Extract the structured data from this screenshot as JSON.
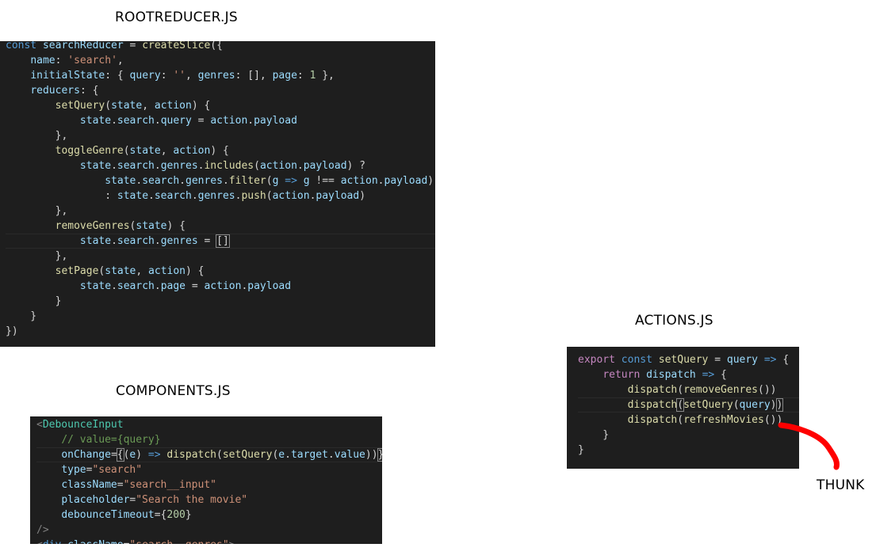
{
  "captions": {
    "rootreducer": "ROOTREDUCER.JS",
    "components": "COMPONENTS.JS",
    "actions": "ACTIONS.JS",
    "thunk": "THUNK"
  },
  "colors": {
    "editor_bg": "#1e1e1e",
    "keyword": "#569cd6",
    "control": "#c586c0",
    "variable": "#9cdcfe",
    "function": "#dcdcaa",
    "string": "#ce9178",
    "number": "#b5cea8",
    "comment": "#6a9955",
    "tag": "#4ec9b0",
    "arrow_annotation": "#ff0000"
  },
  "rootreducer_code": [
    [
      [
        "kw",
        "const"
      ],
      [
        "pun",
        " "
      ],
      [
        "var",
        "searchReducer"
      ],
      [
        "pun",
        " = "
      ],
      [
        "fn",
        "createSlice"
      ],
      [
        "pun",
        "({"
      ]
    ],
    [
      [
        "pun",
        "    "
      ],
      [
        "var",
        "name"
      ],
      [
        "pun",
        ": "
      ],
      [
        "str",
        "'search'"
      ],
      [
        "pun",
        ","
      ]
    ],
    [
      [
        "pun",
        "    "
      ],
      [
        "var",
        "initialState"
      ],
      [
        "pun",
        ": { "
      ],
      [
        "var",
        "query"
      ],
      [
        "pun",
        ": "
      ],
      [
        "str",
        "''"
      ],
      [
        "pun",
        ", "
      ],
      [
        "var",
        "genres"
      ],
      [
        "pun",
        ": [], "
      ],
      [
        "var",
        "page"
      ],
      [
        "pun",
        ": "
      ],
      [
        "num",
        "1"
      ],
      [
        "pun",
        " },"
      ]
    ],
    [
      [
        "pun",
        "    "
      ],
      [
        "var",
        "reducers"
      ],
      [
        "pun",
        ": {"
      ]
    ],
    [
      [
        "pun",
        "        "
      ],
      [
        "fn",
        "setQuery"
      ],
      [
        "pun",
        "("
      ],
      [
        "var",
        "state"
      ],
      [
        "pun",
        ", "
      ],
      [
        "var",
        "action"
      ],
      [
        "pun",
        ") {"
      ]
    ],
    [
      [
        "pun",
        "            "
      ],
      [
        "var",
        "state"
      ],
      [
        "pun",
        "."
      ],
      [
        "var",
        "search"
      ],
      [
        "pun",
        "."
      ],
      [
        "var",
        "query"
      ],
      [
        "pun",
        " = "
      ],
      [
        "var",
        "action"
      ],
      [
        "pun",
        "."
      ],
      [
        "var",
        "payload"
      ]
    ],
    [
      [
        "pun",
        "        },"
      ]
    ],
    [
      [
        "pun",
        "        "
      ],
      [
        "fn",
        "toggleGenre"
      ],
      [
        "pun",
        "("
      ],
      [
        "var",
        "state"
      ],
      [
        "pun",
        ", "
      ],
      [
        "var",
        "action"
      ],
      [
        "pun",
        ") {"
      ]
    ],
    [
      [
        "pun",
        "            "
      ],
      [
        "var",
        "state"
      ],
      [
        "pun",
        "."
      ],
      [
        "var",
        "search"
      ],
      [
        "pun",
        "."
      ],
      [
        "var",
        "genres"
      ],
      [
        "pun",
        "."
      ],
      [
        "fn",
        "includes"
      ],
      [
        "pun",
        "("
      ],
      [
        "var",
        "action"
      ],
      [
        "pun",
        "."
      ],
      [
        "var",
        "payload"
      ],
      [
        "pun",
        ") ?"
      ]
    ],
    [
      [
        "pun",
        "                "
      ],
      [
        "var",
        "state"
      ],
      [
        "pun",
        "."
      ],
      [
        "var",
        "search"
      ],
      [
        "pun",
        "."
      ],
      [
        "var",
        "genres"
      ],
      [
        "pun",
        "."
      ],
      [
        "fn",
        "filter"
      ],
      [
        "pun",
        "("
      ],
      [
        "var",
        "g"
      ],
      [
        "pun",
        " "
      ],
      [
        "kw",
        "=>"
      ],
      [
        "pun",
        " "
      ],
      [
        "var",
        "g"
      ],
      [
        "pun",
        " !== "
      ],
      [
        "var",
        "action"
      ],
      [
        "pun",
        "."
      ],
      [
        "var",
        "payload"
      ],
      [
        "pun",
        ")"
      ]
    ],
    [
      [
        "pun",
        "                : "
      ],
      [
        "var",
        "state"
      ],
      [
        "pun",
        "."
      ],
      [
        "var",
        "search"
      ],
      [
        "pun",
        "."
      ],
      [
        "var",
        "genres"
      ],
      [
        "pun",
        "."
      ],
      [
        "fn",
        "push"
      ],
      [
        "pun",
        "("
      ],
      [
        "var",
        "action"
      ],
      [
        "pun",
        "."
      ],
      [
        "var",
        "payload"
      ],
      [
        "pun",
        ")"
      ]
    ],
    [
      [
        "pun",
        "        },"
      ]
    ],
    [
      [
        "pun",
        "        "
      ],
      [
        "fn",
        "removeGenres"
      ],
      [
        "pun",
        "("
      ],
      [
        "var",
        "state"
      ],
      [
        "pun",
        ") {"
      ]
    ],
    [
      [
        "pun",
        "            "
      ],
      [
        "var",
        "state"
      ],
      [
        "pun",
        "."
      ],
      [
        "var",
        "search"
      ],
      [
        "pun",
        "."
      ],
      [
        "var",
        "genres"
      ],
      [
        "pun",
        " = "
      ],
      [
        "br",
        "[]"
      ]
    ],
    [
      [
        "pun",
        "        },"
      ]
    ],
    [
      [
        "pun",
        "        "
      ],
      [
        "fn",
        "setPage"
      ],
      [
        "pun",
        "("
      ],
      [
        "var",
        "state"
      ],
      [
        "pun",
        ", "
      ],
      [
        "var",
        "action"
      ],
      [
        "pun",
        ") {"
      ]
    ],
    [
      [
        "pun",
        "            "
      ],
      [
        "var",
        "state"
      ],
      [
        "pun",
        "."
      ],
      [
        "var",
        "search"
      ],
      [
        "pun",
        "."
      ],
      [
        "var",
        "page"
      ],
      [
        "pun",
        " = "
      ],
      [
        "var",
        "action"
      ],
      [
        "pun",
        "."
      ],
      [
        "var",
        "payload"
      ]
    ],
    [
      [
        "pun",
        "        }"
      ]
    ],
    [
      [
        "pun",
        "    }"
      ]
    ],
    [
      [
        "pun",
        "})"
      ]
    ]
  ],
  "components_code": [
    [
      [
        "lt",
        "<"
      ],
      [
        "tag",
        "DebounceInput"
      ]
    ],
    [
      [
        "pun",
        "    "
      ],
      [
        "cm",
        "// value={query}"
      ]
    ],
    [
      [
        "pun",
        "    "
      ],
      [
        "attr",
        "onChange"
      ],
      [
        "pun",
        "="
      ],
      [
        "br",
        "{"
      ],
      [
        "pun",
        "("
      ],
      [
        "var",
        "e"
      ],
      [
        "pun",
        ") "
      ],
      [
        "kw",
        "=>"
      ],
      [
        "pun",
        " "
      ],
      [
        "fn",
        "dispatch"
      ],
      [
        "pun",
        "("
      ],
      [
        "fn",
        "setQuery"
      ],
      [
        "pun",
        "("
      ],
      [
        "var",
        "e"
      ],
      [
        "pun",
        "."
      ],
      [
        "var",
        "target"
      ],
      [
        "pun",
        "."
      ],
      [
        "var",
        "value"
      ],
      [
        "pun",
        "))"
      ],
      [
        "br",
        "}"
      ]
    ],
    [
      [
        "pun",
        "    "
      ],
      [
        "attr",
        "type"
      ],
      [
        "pun",
        "="
      ],
      [
        "str",
        "\"search\""
      ]
    ],
    [
      [
        "pun",
        "    "
      ],
      [
        "attr",
        "className"
      ],
      [
        "pun",
        "="
      ],
      [
        "str",
        "\"search__input\""
      ]
    ],
    [
      [
        "pun",
        "    "
      ],
      [
        "attr",
        "placeholder"
      ],
      [
        "pun",
        "="
      ],
      [
        "str",
        "\"Search the movie\""
      ]
    ],
    [
      [
        "pun",
        "    "
      ],
      [
        "attr",
        "debounceTimeout"
      ],
      [
        "pun",
        "={"
      ],
      [
        "num",
        "200"
      ],
      [
        "pun",
        "}"
      ]
    ],
    [
      [
        "lt",
        "/>"
      ]
    ],
    [
      [
        "lt",
        "<"
      ],
      [
        "kw",
        "div"
      ],
      [
        "pun",
        " "
      ],
      [
        "attr",
        "className"
      ],
      [
        "pun",
        "="
      ],
      [
        "str",
        "\"search__genres\""
      ],
      [
        "lt",
        ">"
      ]
    ]
  ],
  "actions_code": [
    [
      [
        "ctl",
        "export"
      ],
      [
        "pun",
        " "
      ],
      [
        "kw",
        "const"
      ],
      [
        "pun",
        " "
      ],
      [
        "fn",
        "setQuery"
      ],
      [
        "pun",
        " = "
      ],
      [
        "var",
        "query"
      ],
      [
        "pun",
        " "
      ],
      [
        "kw",
        "=>"
      ],
      [
        "pun",
        " {"
      ]
    ],
    [
      [
        "pun",
        "    "
      ],
      [
        "ctl",
        "return"
      ],
      [
        "pun",
        " "
      ],
      [
        "var",
        "dispatch"
      ],
      [
        "pun",
        " "
      ],
      [
        "kw",
        "=>"
      ],
      [
        "pun",
        " {"
      ]
    ],
    [
      [
        "pun",
        "        "
      ],
      [
        "fn",
        "dispatch"
      ],
      [
        "pun",
        "("
      ],
      [
        "fn",
        "removeGenres"
      ],
      [
        "pun",
        "())"
      ]
    ],
    [
      [
        "pun",
        "        "
      ],
      [
        "fn",
        "dispatch"
      ],
      [
        "br",
        "("
      ],
      [
        "fn",
        "setQuery"
      ],
      [
        "pun",
        "("
      ],
      [
        "var",
        "query"
      ],
      [
        "pun",
        ")"
      ],
      [
        "br",
        ")"
      ]
    ],
    [
      [
        "pun",
        "        "
      ],
      [
        "fn",
        "dispatch"
      ],
      [
        "pun",
        "("
      ],
      [
        "fn",
        "refreshMovies"
      ],
      [
        "pun",
        "())"
      ]
    ],
    [
      [
        "pun",
        "    }"
      ]
    ],
    [
      [
        "pun",
        "}"
      ]
    ]
  ]
}
